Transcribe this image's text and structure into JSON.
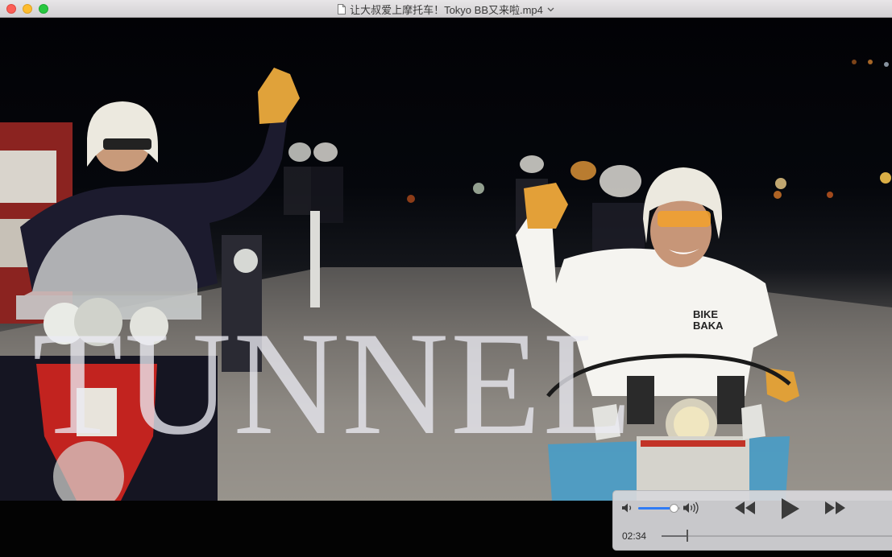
{
  "window": {
    "title": "让大叔爱上摩托车！Tokyo BB又来啦.mp4"
  },
  "video": {
    "overlay_text": "TUNNEL",
    "shirt_text": "BIKE BAKA"
  },
  "player": {
    "current_time": "02:34",
    "volume_level": 0.85,
    "progress": 0.11,
    "icons": [
      "volume-low-icon",
      "volume-high-icon",
      "rewind-icon",
      "play-icon",
      "fast-forward-icon"
    ]
  },
  "colors": {
    "accent": "#2f7bf5",
    "close": "#fc5f57",
    "minimize": "#fdbc2e",
    "zoom": "#28c840"
  }
}
